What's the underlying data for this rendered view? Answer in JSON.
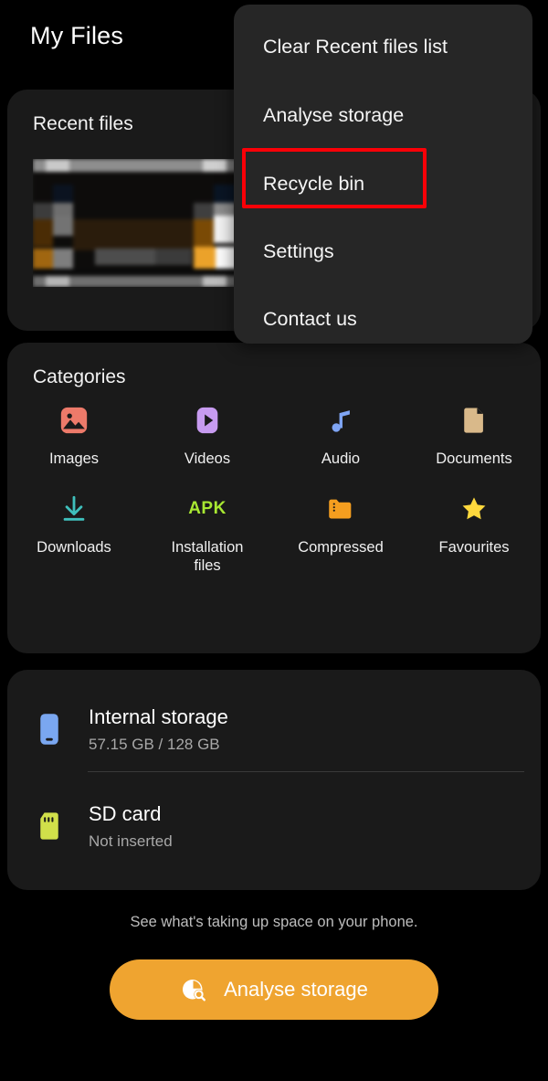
{
  "header": {
    "title": "My Files"
  },
  "recent": {
    "title": "Recent files"
  },
  "categories": {
    "title": "Categories",
    "items": [
      {
        "label": "Images",
        "icon": "image-icon",
        "color": "#ED7A6A"
      },
      {
        "label": "Videos",
        "icon": "video-play-icon",
        "color": "#C79BF0"
      },
      {
        "label": "Audio",
        "icon": "music-note-icon",
        "color": "#7FA5F5"
      },
      {
        "label": "Documents",
        "icon": "document-icon",
        "color": "#D9B98A"
      },
      {
        "label": "Downloads",
        "icon": "download-icon",
        "color": "#3FC0BC"
      },
      {
        "label": "Installation files",
        "icon": "apk-icon",
        "color": "#A8E832"
      },
      {
        "label": "Compressed",
        "icon": "folder-zip-icon",
        "color": "#F59E1F"
      },
      {
        "label": "Favourites",
        "icon": "star-icon",
        "color": "#FFD93D"
      }
    ]
  },
  "storage": {
    "internal": {
      "name": "Internal storage",
      "sub": "57.15 GB / 128 GB",
      "icon": "phone-icon",
      "color": "#7AA7F0"
    },
    "sdcard": {
      "name": "SD card",
      "sub": "Not inserted",
      "icon": "sd-card-icon",
      "color": "#D1E04A"
    }
  },
  "footer": {
    "note": "See what's taking up space on your phone.",
    "button_label": "Analyse storage",
    "button_icon": "pie-search-icon",
    "button_color": "#EFA430"
  },
  "menu": {
    "items": [
      {
        "label": "Clear Recent files list"
      },
      {
        "label": "Analyse storage"
      },
      {
        "label": "Recycle bin"
      },
      {
        "label": "Settings"
      },
      {
        "label": "Contact us"
      }
    ],
    "highlighted_item": "Recycle bin",
    "highlight_color": "#FB0007"
  }
}
